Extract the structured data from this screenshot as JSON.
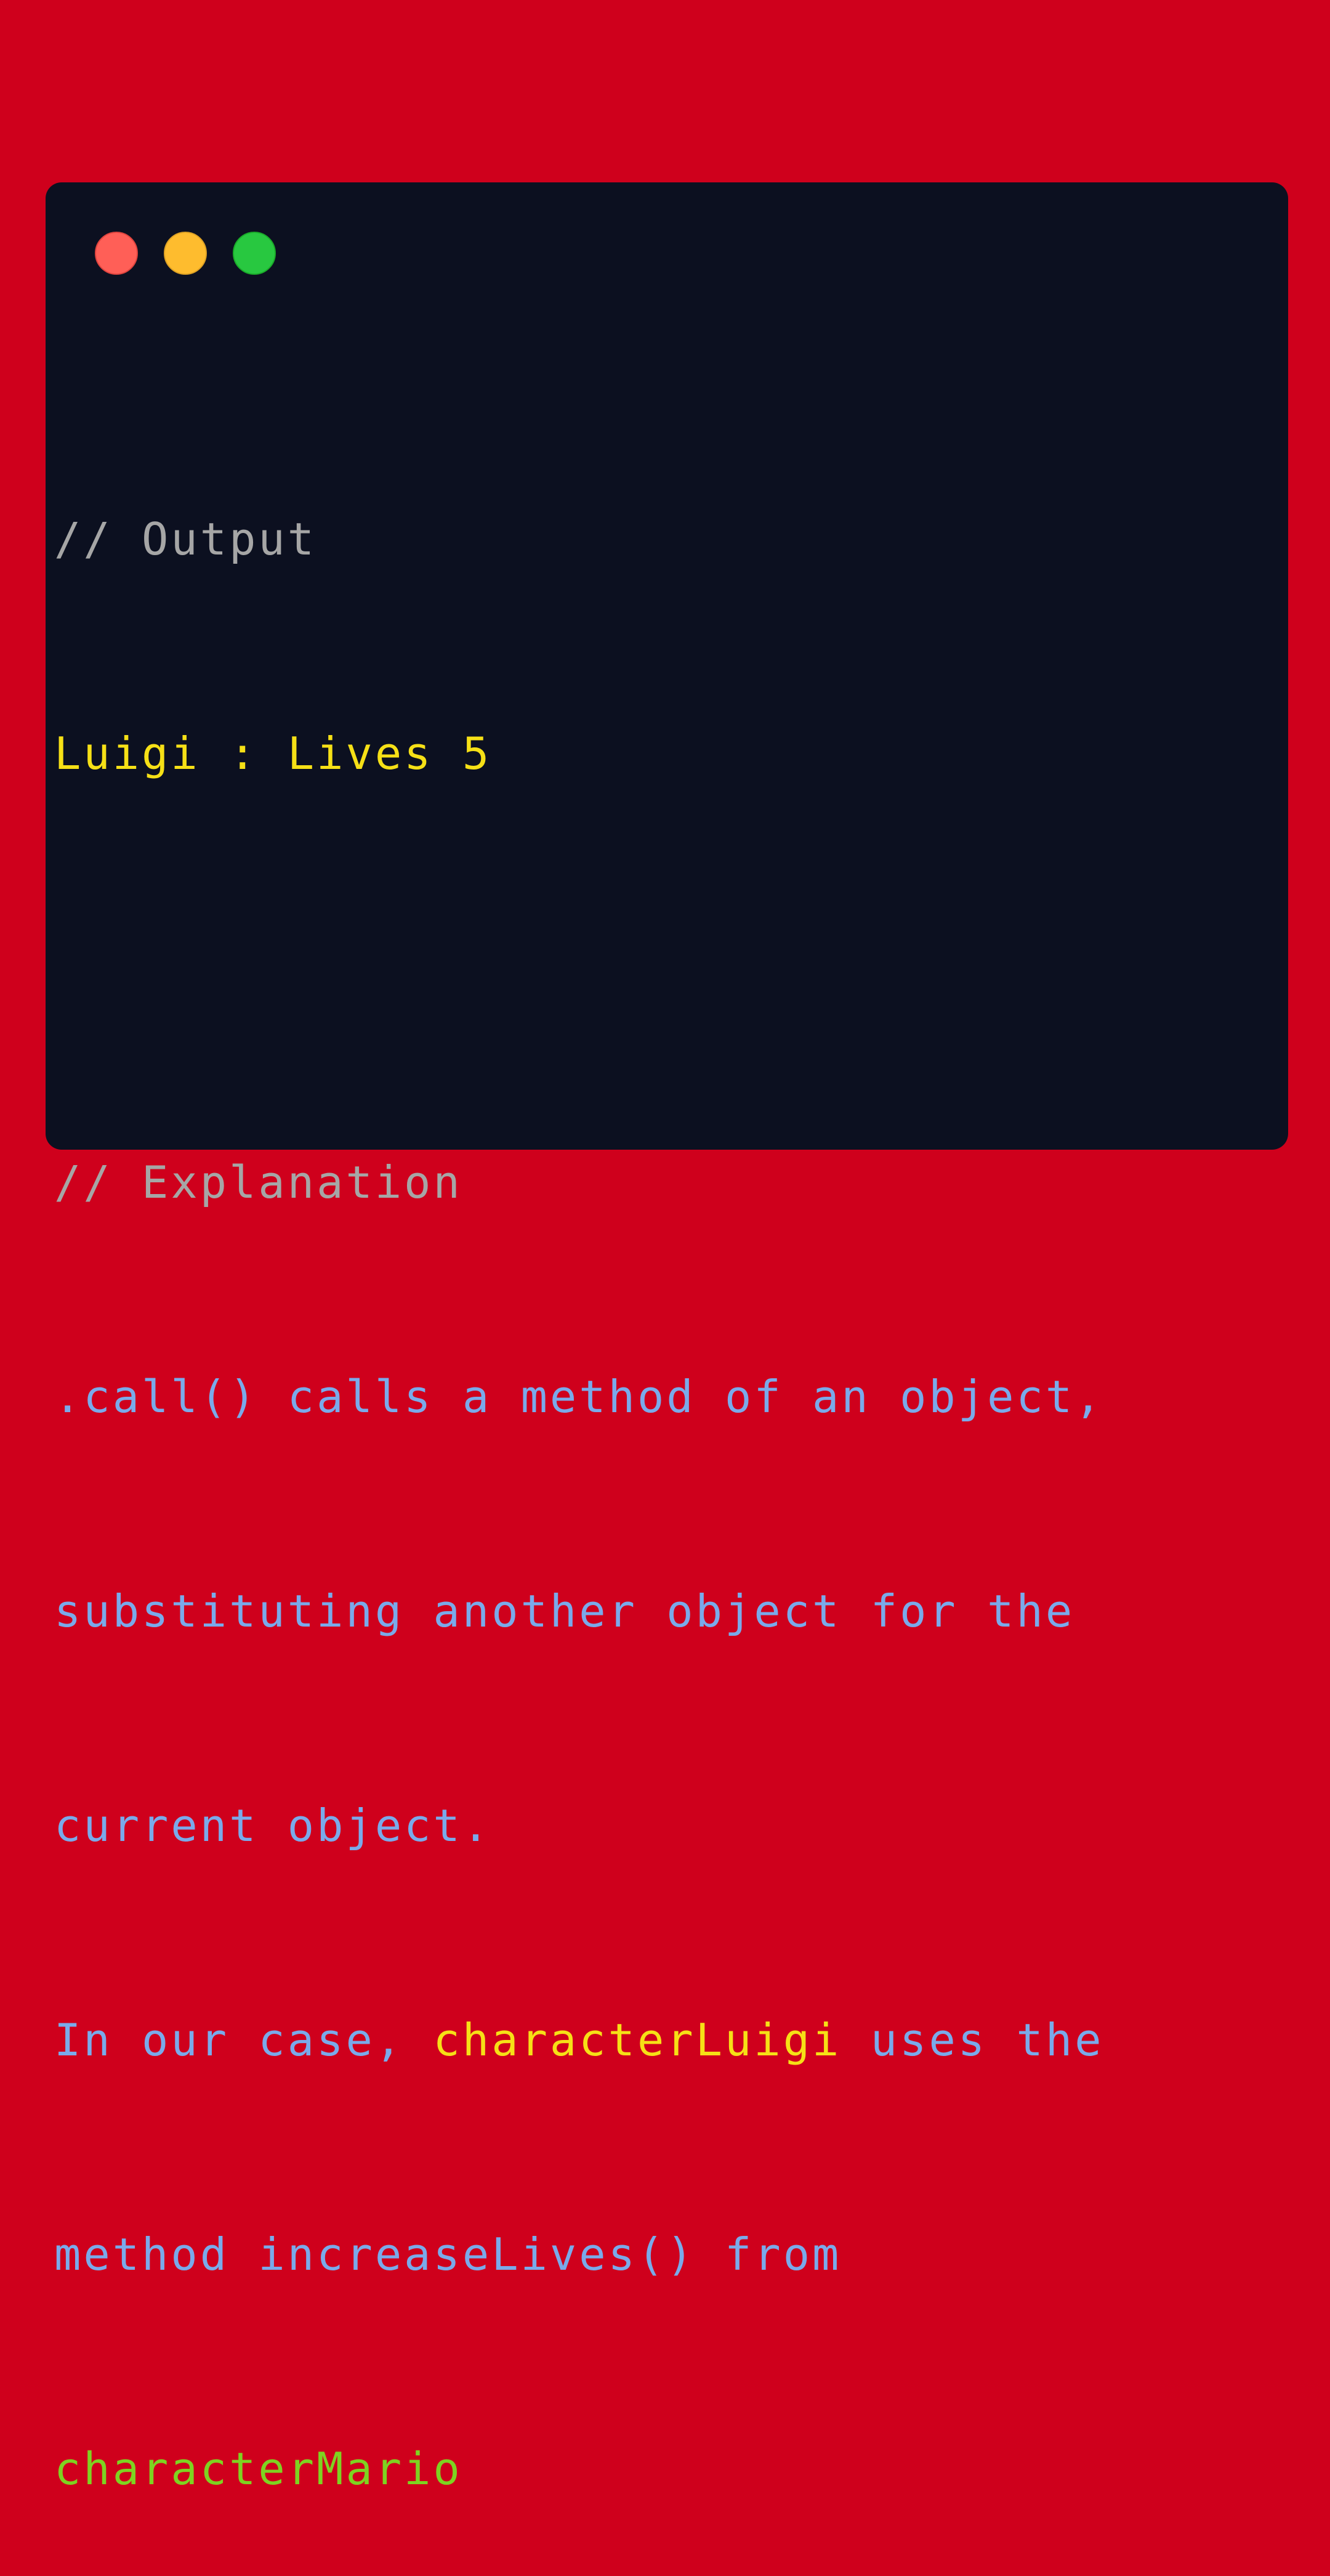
{
  "window": {
    "controls": [
      {
        "name": "close",
        "color": "#ff5f57"
      },
      {
        "name": "minimize",
        "color": "#febc2e"
      },
      {
        "name": "maximize",
        "color": "#28c840"
      }
    ]
  },
  "code": {
    "output_comment": "// Output",
    "output_value": "Luigi : Lives 5",
    "explanation_comment": "// Explanation",
    "line1": ".call() calls a method of an object,",
    "line2": "substituting another object for the",
    "line3": "current object.",
    "line4_prefix": "In our case, ",
    "line4_highlight": "characterLuigi",
    "line4_suffix": " uses the",
    "line5": "method increaseLives() from",
    "line6": "characterMario"
  },
  "colors": {
    "background": "#cf001c",
    "window": "#0c1020",
    "comment": "#a6a6a6",
    "yellow": "#f6e016",
    "blue": "#7aaaea",
    "green": "#7ed321"
  }
}
